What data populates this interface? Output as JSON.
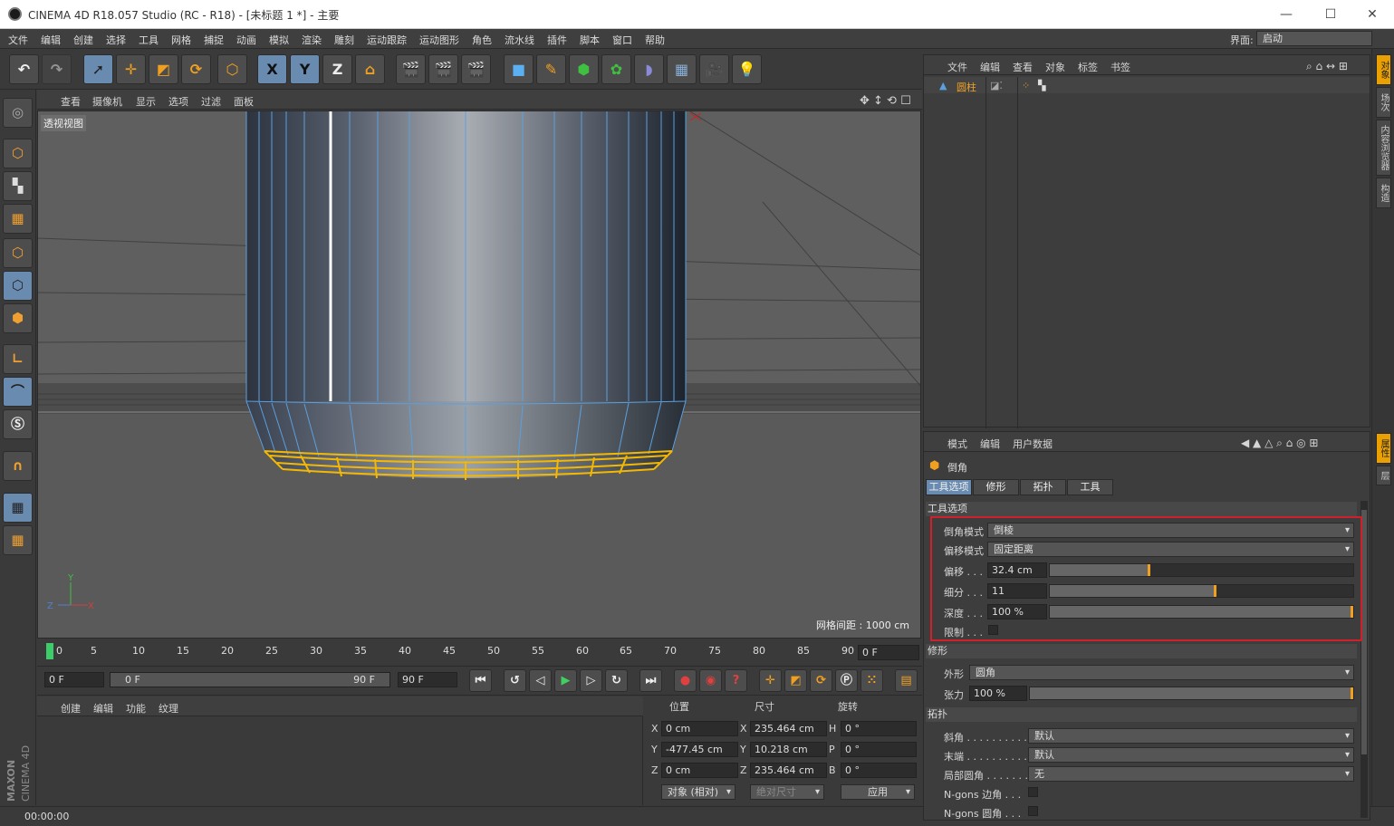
{
  "window": {
    "title": "CINEMA 4D R18.057 Studio (RC - R18) - [未标题 1 *] - 主要",
    "minimize": "—",
    "maximize": "☐",
    "close": "✕"
  },
  "menubar": {
    "items": [
      "文件",
      "编辑",
      "创建",
      "选择",
      "工具",
      "网格",
      "捕捉",
      "动画",
      "模拟",
      "渲染",
      "雕刻",
      "运动跟踪",
      "运动图形",
      "角色",
      "流水线",
      "插件",
      "脚本",
      "窗口",
      "帮助"
    ],
    "layout_label": "界面:",
    "layout_value": "启动"
  },
  "toolbar": {
    "x_label": "X",
    "y_label": "Y",
    "z_label": "Z"
  },
  "viewport": {
    "menu": [
      "查看",
      "摄像机",
      "显示",
      "选项",
      "过滤",
      "面板"
    ],
    "view_label": "透视视图",
    "grid_label": "网格间距 : 1000 cm",
    "axis_x": "X",
    "axis_y": "Y",
    "axis_z": "Z"
  },
  "timeline": {
    "ticks": [
      "0",
      "5",
      "10",
      "15",
      "20",
      "25",
      "30",
      "35",
      "40",
      "45",
      "50",
      "55",
      "60",
      "65",
      "70",
      "75",
      "80",
      "85",
      "90"
    ],
    "current_frame": "0 F"
  },
  "transport": {
    "start": "0 F",
    "range_start": "0 F",
    "range_end": "90 F",
    "end": "90 F"
  },
  "material_panel": {
    "menu": [
      "创建",
      "编辑",
      "功能",
      "纹理"
    ]
  },
  "coords": {
    "headers": {
      "position": "位置",
      "size": "尺寸",
      "rotation": "旋转"
    },
    "rows": [
      {
        "axis": "X",
        "pos": "0 cm",
        "size_axis": "X",
        "size": "235.464 cm",
        "rot_axis": "H",
        "rot": "0 °"
      },
      {
        "axis": "Y",
        "pos": "-477.45 cm",
        "size_axis": "Y",
        "size": "10.218 cm",
        "rot_axis": "P",
        "rot": "0 °"
      },
      {
        "axis": "Z",
        "pos": "0 cm",
        "size_axis": "Z",
        "size": "235.464 cm",
        "rot_axis": "B",
        "rot": "0 °"
      }
    ],
    "mode": "对象 (相对)",
    "size_mode": "绝对尺寸",
    "apply": "应用"
  },
  "status": {
    "time": "00:00:00"
  },
  "object_manager": {
    "menu": [
      "文件",
      "编辑",
      "查看",
      "对象",
      "标签",
      "书签"
    ],
    "object_name": "圆柱"
  },
  "attribute_manager": {
    "menu": [
      "模式",
      "编辑",
      "用户数据"
    ],
    "tool_name": "倒角",
    "tabs": [
      "工具选项",
      "修形",
      "拓扑",
      "工具"
    ],
    "section_tool": "工具选项",
    "bevel_mode_label": "倒角模式",
    "bevel_mode": "倒棱",
    "offset_mode_label": "偏移模式",
    "offset_mode": "固定距离",
    "offset_label": "偏移 . . .",
    "offset_value": "32.4 cm",
    "offset_fraction": 0.33,
    "subdiv_label": "细分 . . .",
    "subdiv_value": "11",
    "subdiv_fraction": 0.55,
    "depth_label": "深度 . . .",
    "depth_value": "100 %",
    "depth_fraction": 1.0,
    "limit_label": "限制 . . .",
    "section_shape": "修形",
    "shape_label": "外形",
    "shape_value": "圆角",
    "tension_label": "张力",
    "tension_value": "100 %",
    "tension_fraction": 1.0,
    "section_topology": "拓扑",
    "miter_label": "斜角 . . . . . . . . . .",
    "miter_value": "默认",
    "endcap_label": "末端 . . . . . . . . . .",
    "endcap_value": "默认",
    "partial_label": "局部圆角 . . . . . . .",
    "partial_value": "无",
    "ngon_edge_label": "N-gons 边角 . . .",
    "ngon_round_label": "N-gons 圆角 . . ."
  },
  "right_tabs": {
    "top": [
      "对象",
      "场次",
      "内容浏览器",
      "构造"
    ],
    "bottom": [
      "属性",
      "层"
    ]
  },
  "colors": {
    "accent_orange": "#f0a020",
    "selected_blue": "#6a8bb0",
    "highlight_red": "#d0202a",
    "wire_blue": "#5aa0e0",
    "bevel_yellow": "#f5b800"
  }
}
